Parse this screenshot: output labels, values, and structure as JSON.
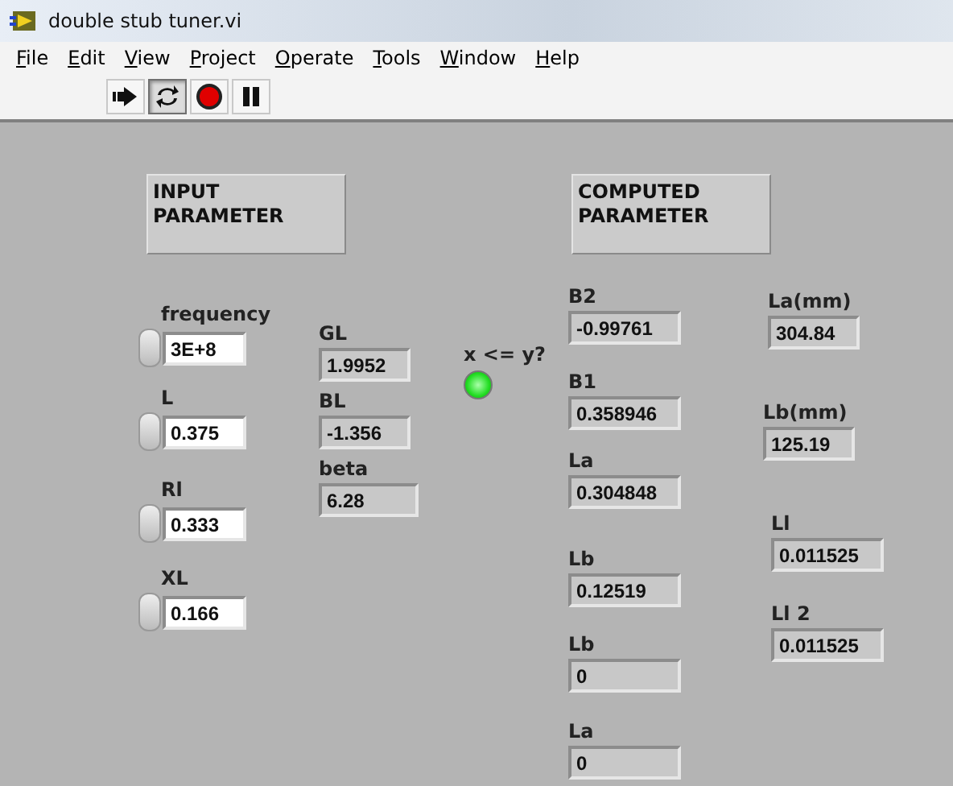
{
  "window": {
    "title": "double stub tuner.vi"
  },
  "menu": [
    "File",
    "Edit",
    "View",
    "Project",
    "Operate",
    "Tools",
    "Window",
    "Help"
  ],
  "toolbar": [
    {
      "kind": "run",
      "pressed": false
    },
    {
      "kind": "run-continuous",
      "pressed": true
    },
    {
      "kind": "abort",
      "pressed": false
    },
    {
      "kind": "pause",
      "pressed": false
    }
  ],
  "sections": [
    "INPUT PARAMETER",
    "COMPUTED PARAMETER"
  ],
  "inputs": [
    {
      "label": "frequency",
      "value": "3E+8"
    },
    {
      "label": "L",
      "value": "0.375"
    },
    {
      "label": "Rl",
      "value": "0.333"
    },
    {
      "label": "XL",
      "value": "0.166"
    }
  ],
  "indicators": [
    {
      "label": "GL",
      "value": "1.9952"
    },
    {
      "label": "BL",
      "value": "-1.356"
    },
    {
      "label": "beta",
      "value": "6.28"
    },
    {
      "label": "B2",
      "value": "-0.99761"
    },
    {
      "label": "B1",
      "value": "0.358946"
    },
    {
      "label": "La",
      "value": "0.304848"
    },
    {
      "label": "Lb",
      "value": "0.12519"
    },
    {
      "label": "Lb",
      "value": "0"
    },
    {
      "label": "La",
      "value": "0"
    },
    {
      "label": "La(mm)",
      "value": "304.84"
    },
    {
      "label": "Lb(mm)",
      "value": "125.19"
    },
    {
      "label": "Ll",
      "value": "0.011525"
    },
    {
      "label": "Ll 2",
      "value": "0.011525"
    }
  ],
  "led": {
    "label": "x <= y?",
    "on": true
  }
}
